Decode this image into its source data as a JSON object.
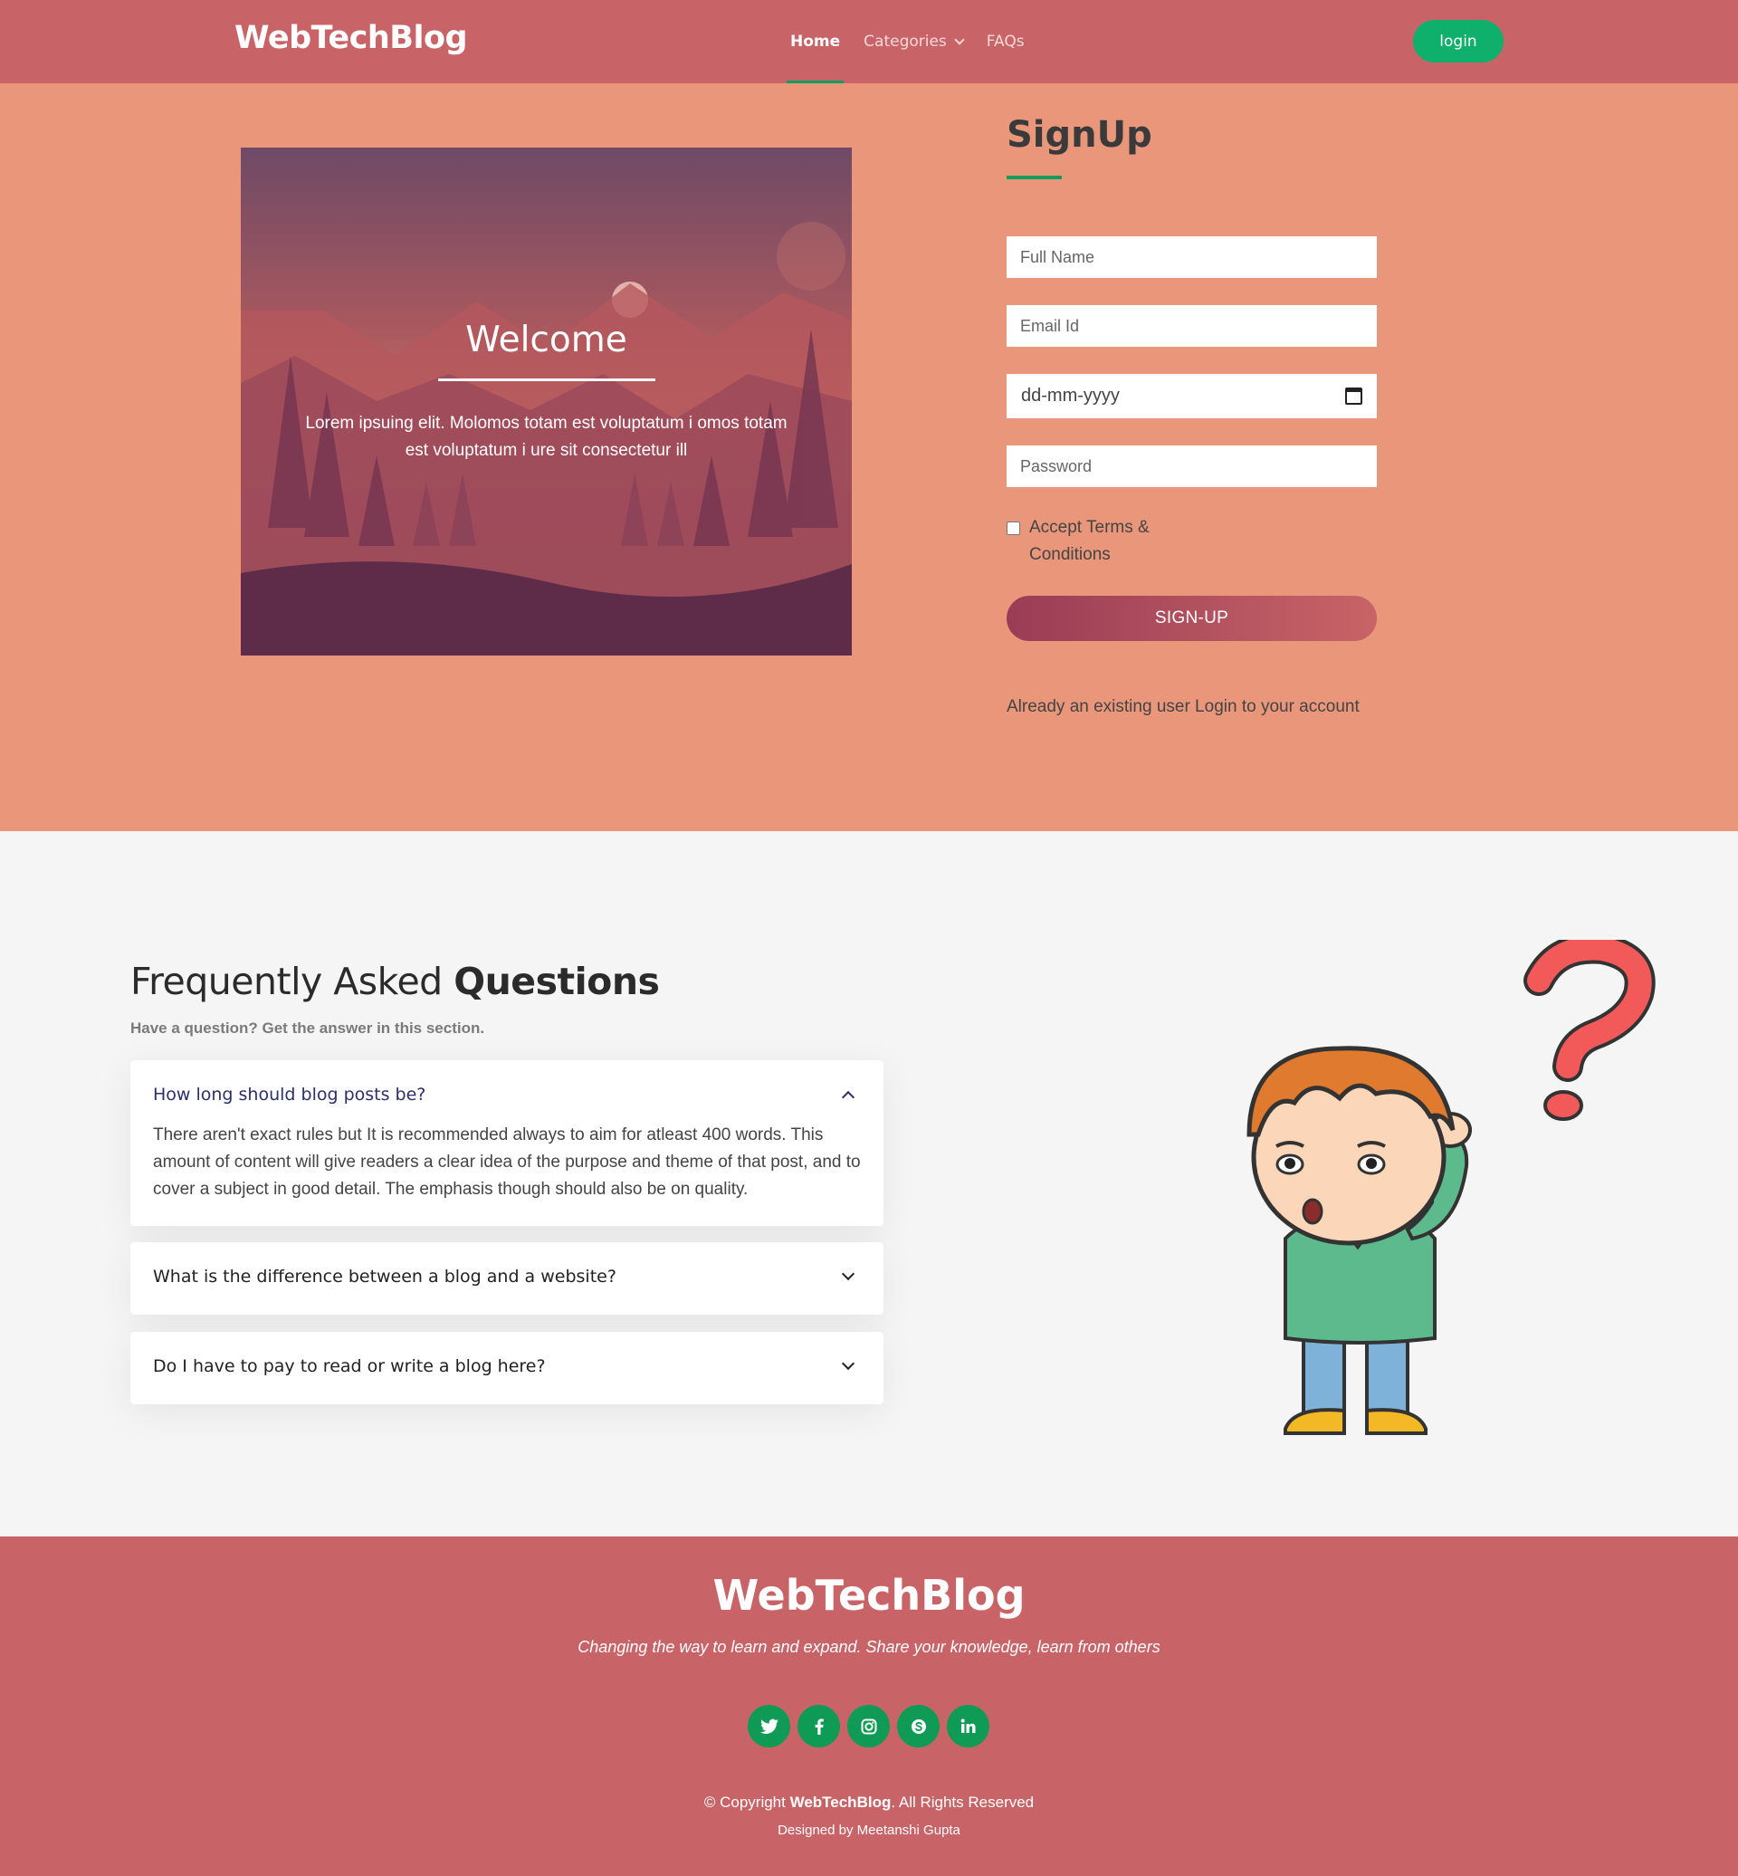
{
  "header": {
    "logo": "WebTechBlog",
    "nav": [
      "Home",
      "Categories",
      "FAQs"
    ],
    "login_label": "login"
  },
  "welcome": {
    "title": "Welcome",
    "text": "Lorem ipsuing elit. Molomos totam est voluptatum i omos totam est voluptatum i ure sit consectetur ill"
  },
  "signup": {
    "title": "SignUp",
    "full_name_placeholder": "Full Name",
    "email_placeholder": "Email Id",
    "date_placeholder": "dd-mm-yyyy",
    "password_placeholder": "Password",
    "terms_line1": "Accept Terms &",
    "terms_line2": "Conditions",
    "button_label": "SIGN-UP",
    "existing_text": "Already an existing user Login to your account"
  },
  "faq": {
    "title_light": "Frequently Asked ",
    "title_bold": "Questions",
    "subtitle": "Have a question? Get the answer in this section.",
    "items": [
      {
        "question": "How long should blog posts be?",
        "answer": "There aren't exact rules but It is recommended always to aim for atleast 400 words. This amount of content will give readers a clear idea of the purpose and theme of that post, and to cover a subject in good detail. The emphasis though should also be on quality."
      },
      {
        "question": "What is the difference between a blog and a website?"
      },
      {
        "question": "Do I have to pay to read or write a blog here?"
      }
    ]
  },
  "footer": {
    "logo": "WebTechBlog",
    "tagline": "Changing the way to learn and expand. Share your knowledge, learn from others",
    "socials": [
      "twitter-icon",
      "facebook-icon",
      "instagram-icon",
      "skype-icon",
      "linkedin-icon"
    ],
    "copyright_prefix": "© Copyright ",
    "copyright_brand": "WebTechBlog",
    "copyright_suffix": ". All Rights Reserved",
    "designed_by": "Designed by Meetanshi Gupta"
  },
  "colors": {
    "header_bg": "#c86467",
    "signup_bg": "#e9967a",
    "accent_green": "#0fb06b",
    "faq_bg": "#f5f5f5"
  }
}
